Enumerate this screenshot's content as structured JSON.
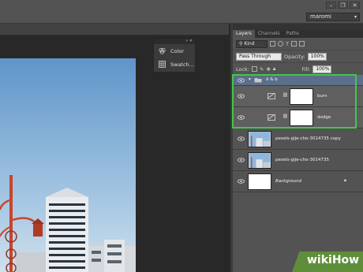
{
  "workspace": {
    "value": "maromi"
  },
  "mini_panel": {
    "items": [
      {
        "label": "Color",
        "icon": "color-wheel-icon"
      },
      {
        "label": "Swatch...",
        "icon": "swatches-grid-icon"
      }
    ]
  },
  "layers_panel": {
    "tabs": [
      "Layers",
      "Channels",
      "Paths"
    ],
    "active_tab": "Layers",
    "filter": "Kind",
    "blend_mode": "Pass Through",
    "opacity_label": "Opacity:",
    "opacity_value": "100%",
    "lock_label": "Lock:",
    "fill_label": "Fill:",
    "fill_value": "100%",
    "layers": [
      {
        "name": "d & b",
        "kind": "group"
      },
      {
        "name": "burn",
        "kind": "fill"
      },
      {
        "name": "dodge",
        "kind": "fill"
      },
      {
        "name": "pexels-gije-cho-3014735 copy",
        "kind": "photo"
      },
      {
        "name": "pexels-gije-cho-3014735",
        "kind": "photo"
      },
      {
        "name": "Background",
        "kind": "background",
        "locked": true
      }
    ]
  },
  "colors": {
    "highlight": "#41c748",
    "panel_bg": "#535353",
    "canvas_bg": "#282828"
  },
  "watermark": {
    "text": "wikiHow"
  }
}
